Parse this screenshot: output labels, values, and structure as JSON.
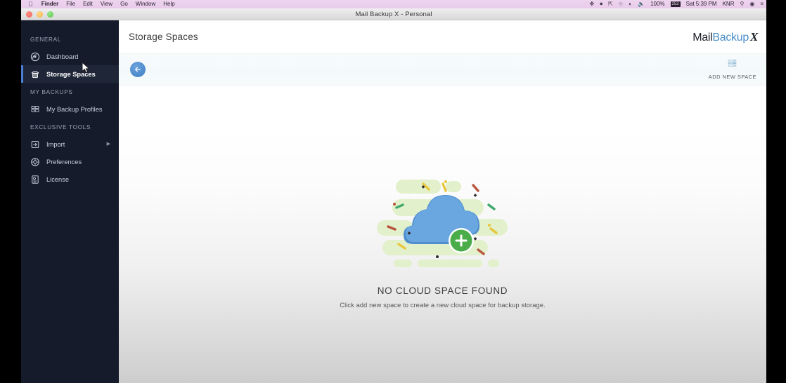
{
  "menubar": {
    "apple_icon": "apple-logo",
    "items": [
      {
        "label": "Finder",
        "bold": true
      },
      {
        "label": "File",
        "bold": false
      },
      {
        "label": "Edit",
        "bold": false
      },
      {
        "label": "View",
        "bold": false
      },
      {
        "label": "Go",
        "bold": false
      },
      {
        "label": "Window",
        "bold": false
      },
      {
        "label": "Help",
        "bold": false
      }
    ],
    "status": {
      "battery_percent": "100%",
      "battery_badge": "252",
      "clock": "Sat 5:39 PM",
      "user": "KNR",
      "icons": [
        "bluetooth-icon",
        "record-icon",
        "airplay-icon",
        "keyboard-icon",
        "wifi-icon",
        "volume-icon",
        "spotlight-search-icon",
        "siri-icon",
        "notification-center-icon"
      ]
    }
  },
  "window": {
    "title": "Mail Backup X - Personal",
    "traffic_lights": [
      "close-button",
      "minimize-button",
      "zoom-button"
    ]
  },
  "sidebar": {
    "groups": [
      {
        "label": "GENERAL",
        "items": [
          {
            "label": "Dashboard",
            "icon": "dashboard-icon",
            "active": false,
            "chevron": false
          },
          {
            "label": "Storage Spaces",
            "icon": "storage-icon",
            "active": true,
            "chevron": false
          }
        ]
      },
      {
        "label": "MY BACKUPS",
        "items": [
          {
            "label": "My Backup Profiles",
            "icon": "profiles-icon",
            "active": false,
            "chevron": false
          }
        ]
      },
      {
        "label": "EXCLUSIVE TOOLS",
        "items": [
          {
            "label": "Import",
            "icon": "import-icon",
            "active": false,
            "chevron": true
          },
          {
            "label": "Preferences",
            "icon": "preferences-icon",
            "active": false,
            "chevron": false
          },
          {
            "label": "License",
            "icon": "license-icon",
            "active": false,
            "chevron": false
          }
        ]
      }
    ]
  },
  "header": {
    "page_title": "Storage Spaces",
    "logo": {
      "part1": "Mail",
      "part2": "Backup",
      "part3": "X"
    }
  },
  "toolbar": {
    "back_label": "back-arrow-icon",
    "add_space_label": "ADD NEW SPACE",
    "add_space_icon": "server-stack-icon"
  },
  "empty_state": {
    "illustration": "cloud-with-plus-illustration",
    "title": "NO CLOUD SPACE FOUND",
    "subtitle": "Click add new space to create a new cloud space for backup storage."
  },
  "colors": {
    "sidebar_bg": "#151b2b",
    "sidebar_active_bg": "#1e2638",
    "accent_blue": "#4a7fd4",
    "logo_blue": "#4a8ec9",
    "cloud_blue": "#5f9cdb",
    "plus_green": "#49b049",
    "illustration_green": "#dff0c8",
    "menubar_bg": "#eed4ee",
    "toolbar_bg": "#f5fafc"
  }
}
